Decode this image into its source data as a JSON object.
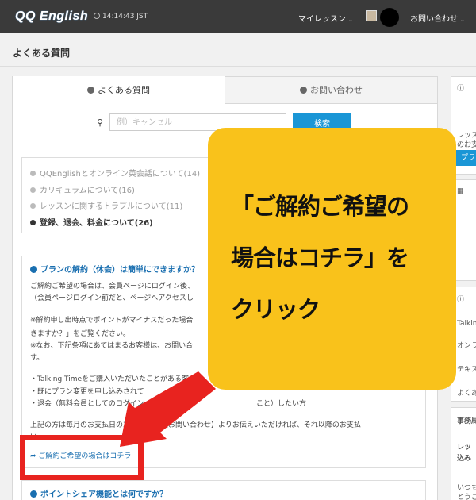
{
  "header": {
    "logo": "QQ English",
    "time": "14:14:43 JST",
    "nav_mylesson": "マイレッスン",
    "nav_contact": "お問い合わせ"
  },
  "page": {
    "title": "よくある質問"
  },
  "tabs": {
    "faq": "よくある質問",
    "contact": "お問い合わせ"
  },
  "search": {
    "placeholder": "例）キャンセル",
    "button": "検索"
  },
  "categories": [
    {
      "label": "QQEnglishとオンライン英会話について(14)"
    },
    {
      "label": "カリキュラムについて(16)"
    },
    {
      "label": "レッスンに関するトラブルについて(11)"
    },
    {
      "label": "登録、退会、料金について(26)"
    }
  ],
  "answer": {
    "question": "プランの解約（休会）は簡単にできますか？",
    "lines": [
      "ご解約ご希望の場合は、会員ページにログイン後、",
      "（会員ページログイン前だと、ページへアクセスし",
      "※解約申し出時点でポイントがマイナスだった場合",
      "きますか？」をご覧ください。",
      "※なお、下記条項にあてはまるお客様は、お問い合",
      "す。",
      "・Talking Timeをご購入いただいたことがある客",
      "・既にプラン変更を申し込みされて",
      "・退会（無料会員としてのログイン",
      "上記の方は毎月のお支払日の3",
      "い"
    ],
    "lines_right": [
      "",
      "",
      "",
      "",
      "",
      "",
      "",
      "",
      "こと）したい方",
      "でに【お問い合わせ】よりお伝えいただければ、それ以降のお支払",
      ""
    ],
    "cta": "ご解約ご希望の場合はコチラ"
  },
  "next_question": "ポイントシェア機能とは何ですか？",
  "sidebar": {
    "lesson_text_1": "レッス",
    "lesson_text_2": "のお支",
    "button": "プラ",
    "items": [
      "Talkin",
      "オンラ",
      "テキス",
      "よくあ"
    ],
    "office_title": "事務局",
    "office_text_1": "レッ",
    "office_text_2": "込み",
    "footer_1": "いつも",
    "footer_2": "とうご"
  },
  "overlay": {
    "lines": [
      "「ご解約ご希望の",
      "場合はコチラ」を",
      "クリック"
    ]
  },
  "colors": {
    "accent": "#1a96d6",
    "link": "#1a6fb0",
    "callout": "#f9c21b",
    "arrow": "#e8231f",
    "header": "#3a3a3a"
  }
}
